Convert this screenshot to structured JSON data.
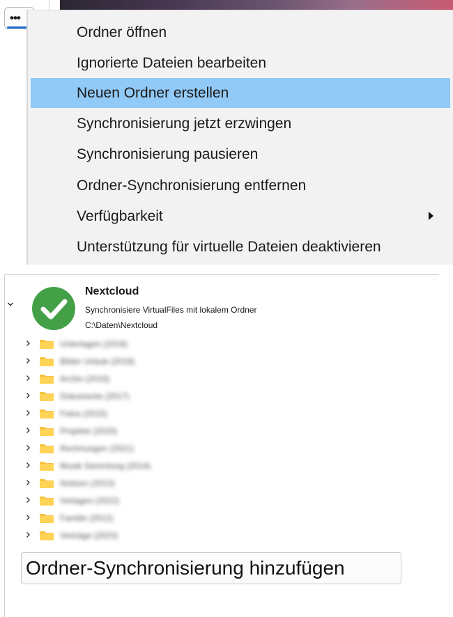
{
  "context_menu": {
    "items": [
      {
        "label": "Ordner öffnen",
        "highlighted": false,
        "has_submenu": false
      },
      {
        "label": "Ignorierte Dateien bearbeiten",
        "highlighted": false,
        "has_submenu": false
      },
      {
        "label": "Neuen Ordner erstellen",
        "highlighted": true,
        "has_submenu": false
      },
      {
        "label": "Synchronisierung jetzt erzwingen",
        "highlighted": false,
        "has_submenu": false
      },
      {
        "label": "Synchronisierung pausieren",
        "highlighted": false,
        "has_submenu": false
      },
      {
        "label": "Ordner-Synchronisierung entfernen",
        "highlighted": false,
        "has_submenu": false
      },
      {
        "label": "Verfügbarkeit",
        "highlighted": false,
        "has_submenu": true
      },
      {
        "label": "Unterstützung für virtuelle Dateien deaktivieren",
        "highlighted": false,
        "has_submenu": false
      }
    ],
    "highlight_color": "#91c9f7"
  },
  "more_button": {
    "label": "•••",
    "icon": "more-dots-icon"
  },
  "sync_folder": {
    "account_name": "Nextcloud",
    "status_text": "Synchronisiere VirtualFiles mit lokalem Ordner",
    "local_path": "C:\\Daten\\Nextcloud",
    "status_icon": "checkmark-circle-icon",
    "status_color": "#43a047",
    "subfolders": [
      {
        "label": "Unterlagen (2019)"
      },
      {
        "label": "Bilder Urlaub (2018)"
      },
      {
        "label": "Archiv (2016)"
      },
      {
        "label": "Dokumente (2017)"
      },
      {
        "label": "Fotos (2015)"
      },
      {
        "label": "Projekte (2020)"
      },
      {
        "label": "Rechnungen (2021)"
      },
      {
        "label": "Musik Sammlung (2014)"
      },
      {
        "label": "Notizen (2013)"
      },
      {
        "label": "Vorlagen (2022)"
      },
      {
        "label": "Familie (2012)"
      },
      {
        "label": "Verträge (2023)"
      }
    ]
  },
  "add_sync_button": {
    "label": "Ordner-Synchronisierung hinzufügen"
  }
}
